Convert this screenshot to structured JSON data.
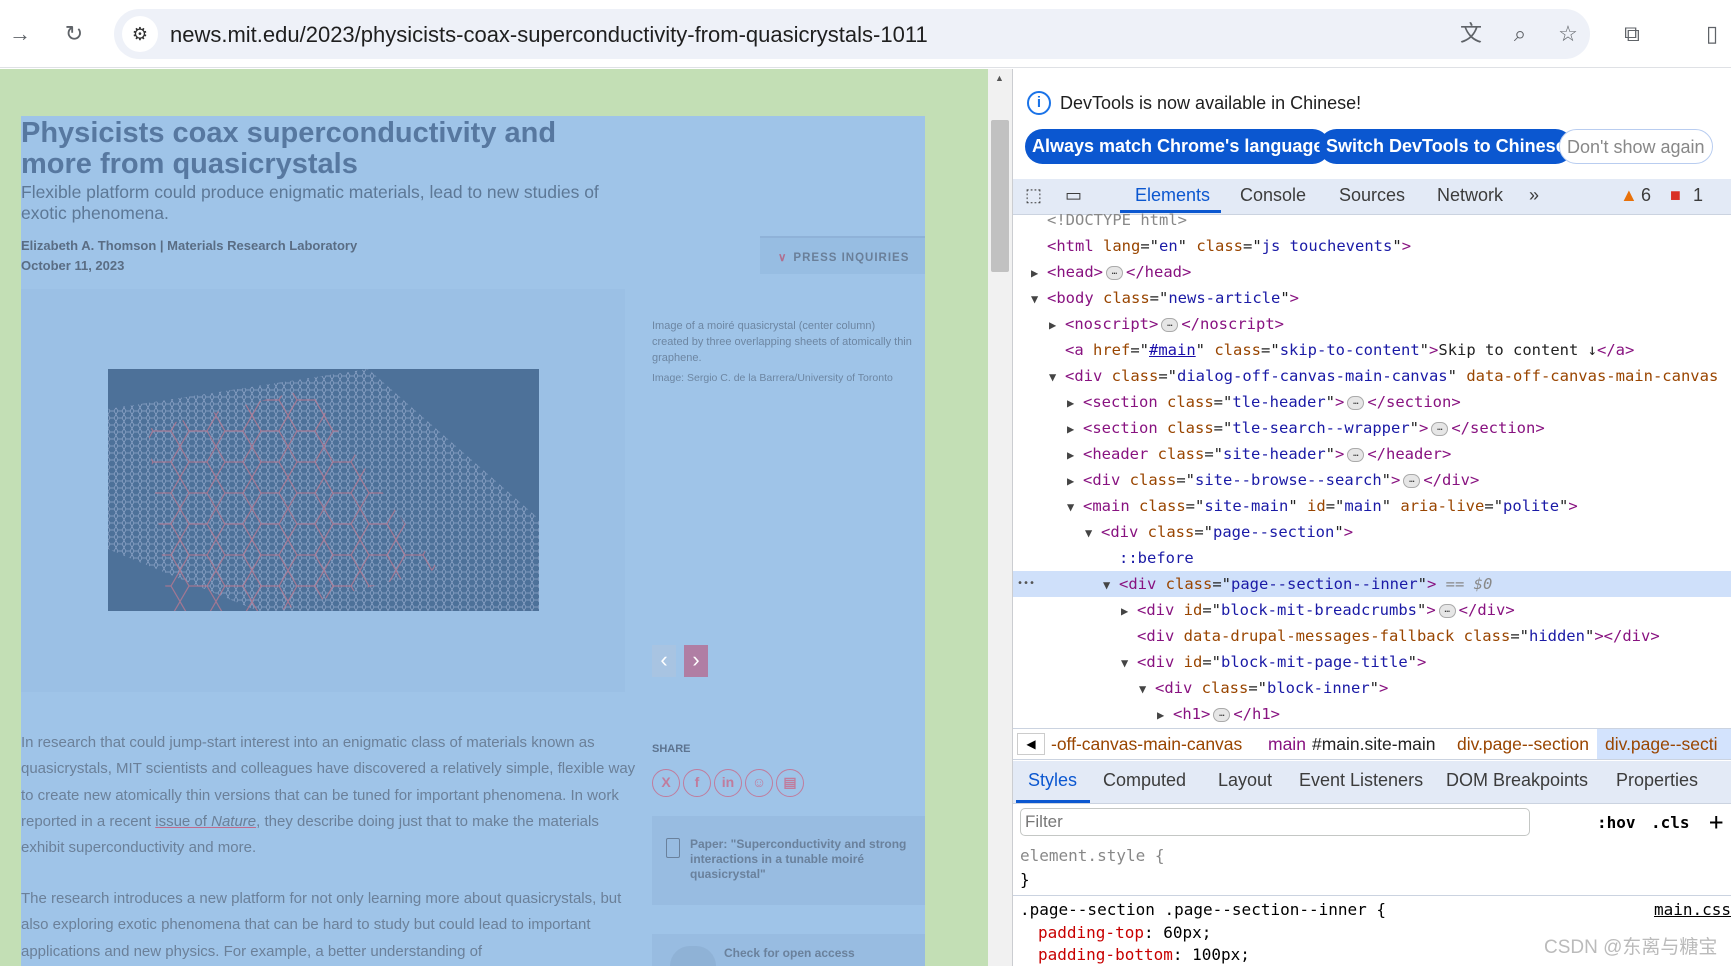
{
  "browser": {
    "url": "news.mit.edu/2023/physicists-coax-superconductivity-from-quasicrystals-1011",
    "icons": [
      "forward-icon",
      "reload-icon",
      "site-settings-icon",
      "translate-icon",
      "zoom-icon",
      "bookmark-star-icon",
      "extensions-icon",
      "side-panel-icon"
    ]
  },
  "article": {
    "title": "Physicists coax superconductivity and more from quasicrystals",
    "subtitle": "Flexible platform could produce enigmatic materials, lead to new studies of exotic phenomena.",
    "author": "Elizabeth A. Thomson | Materials Research Laboratory",
    "date": "October 11, 2023",
    "press": "PRESS INQUIRIES",
    "caption": "Image of a moiré quasicrystal (center column) created by three overlapping sheets of atomically thin graphene.",
    "credit": "Image: Sergio C. de la Barrera/University of Toronto",
    "p1a": "In research that could jump-start interest into an enigmatic class of materials known as quasicrystals, MIT scientists and colleagues have discovered a relatively simple, flexible way to create new atomically thin versions that can be tuned for important phenomena. In work reported in a recent ",
    "p1link": "issue of ",
    "p1linkit": "Nature",
    "p1b": ", they describe doing just that to make the materials exhibit superconductivity and more.",
    "p2": "The research introduces a new platform for not only learning more about quasicrystals, but also exploring exotic phenomena that can be hard to study but could lead to important applications and new physics. For example, a better understanding of",
    "share": "SHARE",
    "paper": "Paper: \"Superconductivity and strong interactions in a tunable moiré quasicrystal\"",
    "open_access": "Check for open access",
    "highlight": "#9fc4e8",
    "margin_color": "#c3dfb5",
    "accent": "#c07c9d"
  },
  "devtools": {
    "info": "DevTools is now available in Chinese!",
    "buttons": [
      "Always match Chrome's language",
      "Switch DevTools to Chinese",
      "Don't show again"
    ],
    "tabs": [
      "Elements",
      "Console",
      "Sources",
      "Network"
    ],
    "warnings": "6",
    "errors": "1",
    "tree": [
      {
        "i": 0,
        "a": "",
        "p": [
          [
            "cm",
            "<!DOCTYPE html>"
          ]
        ]
      },
      {
        "i": 0,
        "a": "",
        "p": [
          [
            "tg",
            "<html "
          ],
          [
            "at",
            "lang"
          ],
          [
            "tx",
            "=\""
          ],
          [
            "av",
            "en"
          ],
          [
            "tx",
            "\" "
          ],
          [
            "at",
            "class"
          ],
          [
            "tx",
            "=\""
          ],
          [
            "av",
            "js touchevents"
          ],
          [
            "tx",
            "\""
          ],
          [
            "tg",
            ">"
          ]
        ]
      },
      {
        "i": 0,
        "a": "▶",
        "p": [
          [
            "tg",
            "<head>"
          ],
          [
            "e",
            ""
          ],
          [
            "tg",
            "</head>"
          ]
        ]
      },
      {
        "i": 0,
        "a": "▼",
        "p": [
          [
            "tg",
            "<body "
          ],
          [
            "at",
            "class"
          ],
          [
            "tx",
            "=\""
          ],
          [
            "av",
            "news-article"
          ],
          [
            "tx",
            "\""
          ],
          [
            "tg",
            ">"
          ]
        ]
      },
      {
        "i": 1,
        "a": "▶",
        "p": [
          [
            "tg",
            "<noscript>"
          ],
          [
            "e",
            ""
          ],
          [
            "tg",
            "</noscript>"
          ]
        ]
      },
      {
        "i": 1,
        "a": "",
        "p": [
          [
            "tg",
            "<a "
          ],
          [
            "at",
            "href"
          ],
          [
            "tx",
            "=\""
          ],
          [
            "av",
            "#main"
          ],
          [
            "tx",
            "\" "
          ],
          [
            "at",
            "class"
          ],
          [
            "tx",
            "=\""
          ],
          [
            "av",
            "skip-to-content"
          ],
          [
            "tx",
            "\""
          ],
          [
            "tg",
            ">"
          ],
          [
            "tx",
            "Skip to content ↓"
          ],
          [
            "tg",
            "</a>"
          ]
        ]
      },
      {
        "i": 1,
        "a": "▼",
        "p": [
          [
            "tg",
            "<div "
          ],
          [
            "at",
            "class"
          ],
          [
            "tx",
            "=\""
          ],
          [
            "av",
            "dialog-off-canvas-main-canvas"
          ],
          [
            "tx",
            "\" "
          ],
          [
            "at",
            "data-off-canvas-main-canvas"
          ]
        ]
      },
      {
        "i": 2,
        "a": "▶",
        "p": [
          [
            "tg",
            "<section "
          ],
          [
            "at",
            "class"
          ],
          [
            "tx",
            "=\""
          ],
          [
            "av",
            "tle-header"
          ],
          [
            "tx",
            "\""
          ],
          [
            "tg",
            ">"
          ],
          [
            "e",
            ""
          ],
          [
            "tg",
            "</section>"
          ]
        ]
      },
      {
        "i": 2,
        "a": "▶",
        "p": [
          [
            "tg",
            "<section "
          ],
          [
            "at",
            "class"
          ],
          [
            "tx",
            "=\""
          ],
          [
            "av",
            "tle-search--wrapper"
          ],
          [
            "tx",
            "\""
          ],
          [
            "tg",
            ">"
          ],
          [
            "e",
            ""
          ],
          [
            "tg",
            "</section>"
          ]
        ]
      },
      {
        "i": 2,
        "a": "▶",
        "p": [
          [
            "tg",
            "<header "
          ],
          [
            "at",
            "class"
          ],
          [
            "tx",
            "=\""
          ],
          [
            "av",
            "site-header"
          ],
          [
            "tx",
            "\""
          ],
          [
            "tg",
            ">"
          ],
          [
            "e",
            ""
          ],
          [
            "tg",
            "</header>"
          ]
        ]
      },
      {
        "i": 2,
        "a": "▶",
        "p": [
          [
            "tg",
            "<div "
          ],
          [
            "at",
            "class"
          ],
          [
            "tx",
            "=\""
          ],
          [
            "av",
            "site--browse--search"
          ],
          [
            "tx",
            "\""
          ],
          [
            "tg",
            ">"
          ],
          [
            "e",
            ""
          ],
          [
            "tg",
            "</div>"
          ]
        ]
      },
      {
        "i": 2,
        "a": "▼",
        "p": [
          [
            "tg",
            "<main "
          ],
          [
            "at",
            "class"
          ],
          [
            "tx",
            "=\""
          ],
          [
            "av",
            "site-main"
          ],
          [
            "tx",
            "\" "
          ],
          [
            "at",
            "id"
          ],
          [
            "tx",
            "=\""
          ],
          [
            "av",
            "main"
          ],
          [
            "tx",
            "\" "
          ],
          [
            "at",
            "aria-live"
          ],
          [
            "tx",
            "=\""
          ],
          [
            "av",
            "polite"
          ],
          [
            "tx",
            "\""
          ],
          [
            "tg",
            ">"
          ]
        ]
      },
      {
        "i": 3,
        "a": "▼",
        "p": [
          [
            "tg",
            "<div "
          ],
          [
            "at",
            "class"
          ],
          [
            "tx",
            "=\""
          ],
          [
            "av",
            "page--section"
          ],
          [
            "tx",
            "\""
          ],
          [
            "tg",
            ">"
          ]
        ]
      },
      {
        "i": 4,
        "a": "",
        "p": [
          [
            "ps",
            "::before"
          ]
        ]
      },
      {
        "i": 4,
        "a": "▼",
        "sel": true,
        "p": [
          [
            "tg",
            "<div "
          ],
          [
            "at",
            "class"
          ],
          [
            "tx",
            "=\""
          ],
          [
            "av",
            "page--section--inner"
          ],
          [
            "tx",
            "\""
          ],
          [
            "tg",
            ">"
          ],
          [
            "eq",
            " == $0"
          ]
        ]
      },
      {
        "i": 5,
        "a": "▶",
        "p": [
          [
            "tg",
            "<div "
          ],
          [
            "at",
            "id"
          ],
          [
            "tx",
            "=\""
          ],
          [
            "av",
            "block-mit-breadcrumbs"
          ],
          [
            "tx",
            "\""
          ],
          [
            "tg",
            ">"
          ],
          [
            "e",
            ""
          ],
          [
            "tg",
            "</div>"
          ]
        ]
      },
      {
        "i": 5,
        "a": "",
        "p": [
          [
            "tg",
            "<div "
          ],
          [
            "at",
            "data-drupal-messages-fallback "
          ],
          [
            "at",
            "class"
          ],
          [
            "tx",
            "=\""
          ],
          [
            "av",
            "hidden"
          ],
          [
            "tx",
            "\""
          ],
          [
            "tg",
            "></div>"
          ]
        ]
      },
      {
        "i": 5,
        "a": "▼",
        "p": [
          [
            "tg",
            "<div "
          ],
          [
            "at",
            "id"
          ],
          [
            "tx",
            "=\""
          ],
          [
            "av",
            "block-mit-page-title"
          ],
          [
            "tx",
            "\""
          ],
          [
            "tg",
            ">"
          ]
        ]
      },
      {
        "i": 6,
        "a": "▼",
        "p": [
          [
            "tg",
            "<div "
          ],
          [
            "at",
            "class"
          ],
          [
            "tx",
            "=\""
          ],
          [
            "av",
            "block-inner"
          ],
          [
            "tx",
            "\""
          ],
          [
            "tg",
            ">"
          ]
        ]
      },
      {
        "i": 7,
        "a": "▶",
        "p": [
          [
            "tg",
            "<h1>"
          ],
          [
            "e",
            ""
          ],
          [
            "tg",
            "</h1>"
          ]
        ]
      }
    ],
    "breadcrumbs": [
      "-off-canvas-main-canvas",
      "main",
      "#main.site-main",
      "div.page--section",
      "div.page--secti"
    ],
    "style_tabs": [
      "Styles",
      "Computed",
      "Layout",
      "Event Listeners",
      "DOM Breakpoints",
      "Properties"
    ],
    "filter_placeholder": "Filter",
    "hov": ":hov",
    "cls": ".cls",
    "element_style": "element.style {",
    "close_brace": "}",
    "rule_selector": ".page--section .page--section--inner {",
    "rule_source": "main.css",
    "props": [
      [
        "padding-top",
        "60px;"
      ],
      [
        "padding-bottom",
        "100px;"
      ]
    ]
  },
  "watermark": "CSDN @东离与糖宝"
}
